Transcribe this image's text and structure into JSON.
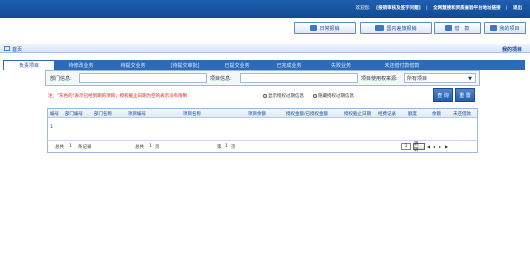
{
  "topbar": {
    "welcome": "欢迎您:",
    "user": "[报销审核及签字问题]",
    "link1": "全网慧搜和资质查验平台地址链接",
    "logout": "退出"
  },
  "toolbar": {
    "daily_reimb": "日常报销",
    "domestic_travel": "国内差旅报销",
    "loan": "借　款",
    "my_projects": "我的项目"
  },
  "homebar": {
    "home": "首页",
    "right_label": "我的项目"
  },
  "tabs": [
    {
      "label": "负责项目"
    },
    {
      "label": "待修改业务"
    },
    {
      "label": "待提交业务"
    },
    {
      "label": "[待提交审批]"
    },
    {
      "label": "已提交业务"
    },
    {
      "label": "已完成业务"
    },
    {
      "label": "失败业务"
    },
    {
      "label": "未还借付款借款"
    }
  ],
  "filter": {
    "dept_label": "部门信息:",
    "project_label": "项目信息:",
    "scope_label": "项目使用权来源:",
    "scope_value": "所有项目"
  },
  "notice": {
    "text": "注：\"灰色的\"表示已经到期的项目；授权截止日期为空的表示没有限制",
    "radio1": "显示授权过期信息",
    "radio2": "隐藏授权过期信息"
  },
  "actions": {
    "query": "查 询",
    "reset": "重 置"
  },
  "grid": {
    "columns": [
      "编号",
      "部门编号",
      "部门名称",
      "项目编号",
      "项目名称",
      "项目余额",
      "授权金额/已授权金额",
      "授权截止日期",
      "经费记录",
      "额度",
      "余额",
      "未还借款"
    ],
    "row_number": "1"
  },
  "pager": {
    "total_label": "总共",
    "total_records": "1",
    "records_unit": "条记录",
    "total_pages_label": "总共",
    "total_pages": "1",
    "pages_unit": "页",
    "current_label": "第",
    "current_page": "1",
    "current_unit": "页",
    "goto_value": "1",
    "goto_button": "跳 转"
  },
  "icons": {
    "daily_reimb": "form-icon",
    "domestic_travel": "car-icon",
    "loan": "card-icon",
    "my_projects": "folder-icon",
    "home": "monitor-icon"
  },
  "colors": {
    "brand": "#1f5fb0",
    "tab_bar": "#2e6ab8",
    "notice": "#d31a1a"
  }
}
